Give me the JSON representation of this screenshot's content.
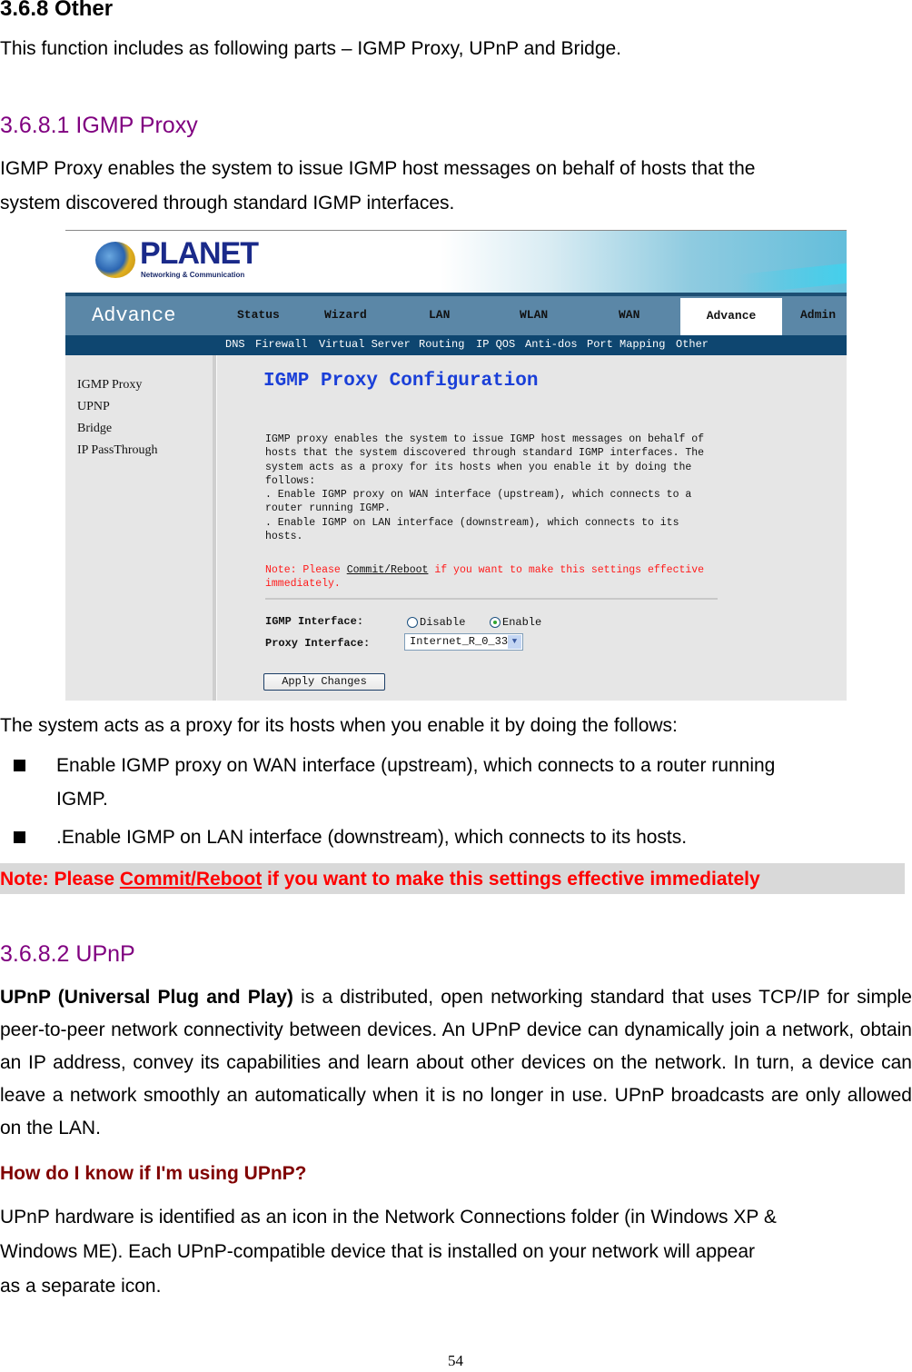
{
  "section": {
    "title": "3.6.8 Other",
    "intro": "This function includes as following parts – IGMP Proxy, UPnP and Bridge."
  },
  "igmp": {
    "title": "3.6.8.1 IGMP Proxy",
    "desc_line1": "IGMP Proxy enables the system to issue IGMP host messages on behalf of hosts that the",
    "desc_line2": "system discovered through standard IGMP interfaces.",
    "follow_text": "The system acts as a proxy for its hosts when you enable it by doing the follows:",
    "bullets": [
      {
        "line1": "Enable IGMP proxy on WAN interface (upstream), which connects to a router running",
        "line2": "IGMP."
      },
      {
        "line1": ".Enable IGMP on LAN interface (downstream), which connects to its hosts."
      }
    ],
    "note": {
      "prefix": "Note: Please ",
      "link": "Commit/Reboot",
      "suffix": " if you want to make this settings effective immediately"
    }
  },
  "screenshot": {
    "logo": {
      "brand": "PLANET",
      "tagline": "Networking & Communication"
    },
    "nav_title": "Advance",
    "nav_items": [
      "Status",
      "Wizard",
      "LAN",
      "WLAN",
      "WAN",
      "Advance",
      "Admin"
    ],
    "active_nav": "Advance",
    "sub_items": [
      "DNS",
      "Firewall",
      "Virtual Server",
      "Routing",
      "IP QOS",
      "Anti-dos",
      "Port Mapping",
      "Other"
    ],
    "side_items": [
      "IGMP Proxy",
      "UPNP",
      "Bridge",
      "IP PassThrough"
    ],
    "page_title": "IGMP Proxy Configuration",
    "description": "IGMP proxy enables the system to issue IGMP host messages on behalf of\nhosts that the system discovered through standard IGMP interfaces. The\nsystem acts as a proxy for its hosts when you enable it by doing the\nfollows:\n. Enable IGMP proxy on WAN interface (upstream), which connects to a\nrouter running IGMP.\n. Enable IGMP on LAN interface (downstream), which connects to its\nhosts.",
    "note_prefix": "Note: Please ",
    "note_link": "Commit/Reboot",
    "note_suffix": " if you want to make this settings effective\nimmediately.",
    "igmp_interface_label": "IGMP Interface:",
    "radio_disable": "Disable",
    "radio_enable": "Enable",
    "igmp_interface_value": "Enable",
    "proxy_interface_label": "Proxy Interface:",
    "proxy_interface_value": "Internet_R_0_33",
    "apply_button": "Apply Changes"
  },
  "upnp": {
    "title": "3.6.8.2 UPnP",
    "bold_lead": "UPnP (Universal Plug and Play)",
    "para": " is a distributed, open networking standard that uses TCP/IP for simple peer-to-peer network connectivity between devices. An UPnP device can dynamically join a network, obtain an IP address, convey its capabilities and learn about other devices on the network. In turn, a device can leave a network smoothly an automatically when it is no longer in use. UPnP broadcasts are only allowed on the LAN.",
    "question": "How do I know if I'm using UPnP?",
    "answer_line1": "UPnP hardware is identified as an icon in the Network Connections folder (in Windows XP &",
    "answer_line2": "Windows ME). Each UPnP-compatible device that is installed on your network will appear",
    "answer_line3": "as a separate icon."
  },
  "page_number": "54"
}
